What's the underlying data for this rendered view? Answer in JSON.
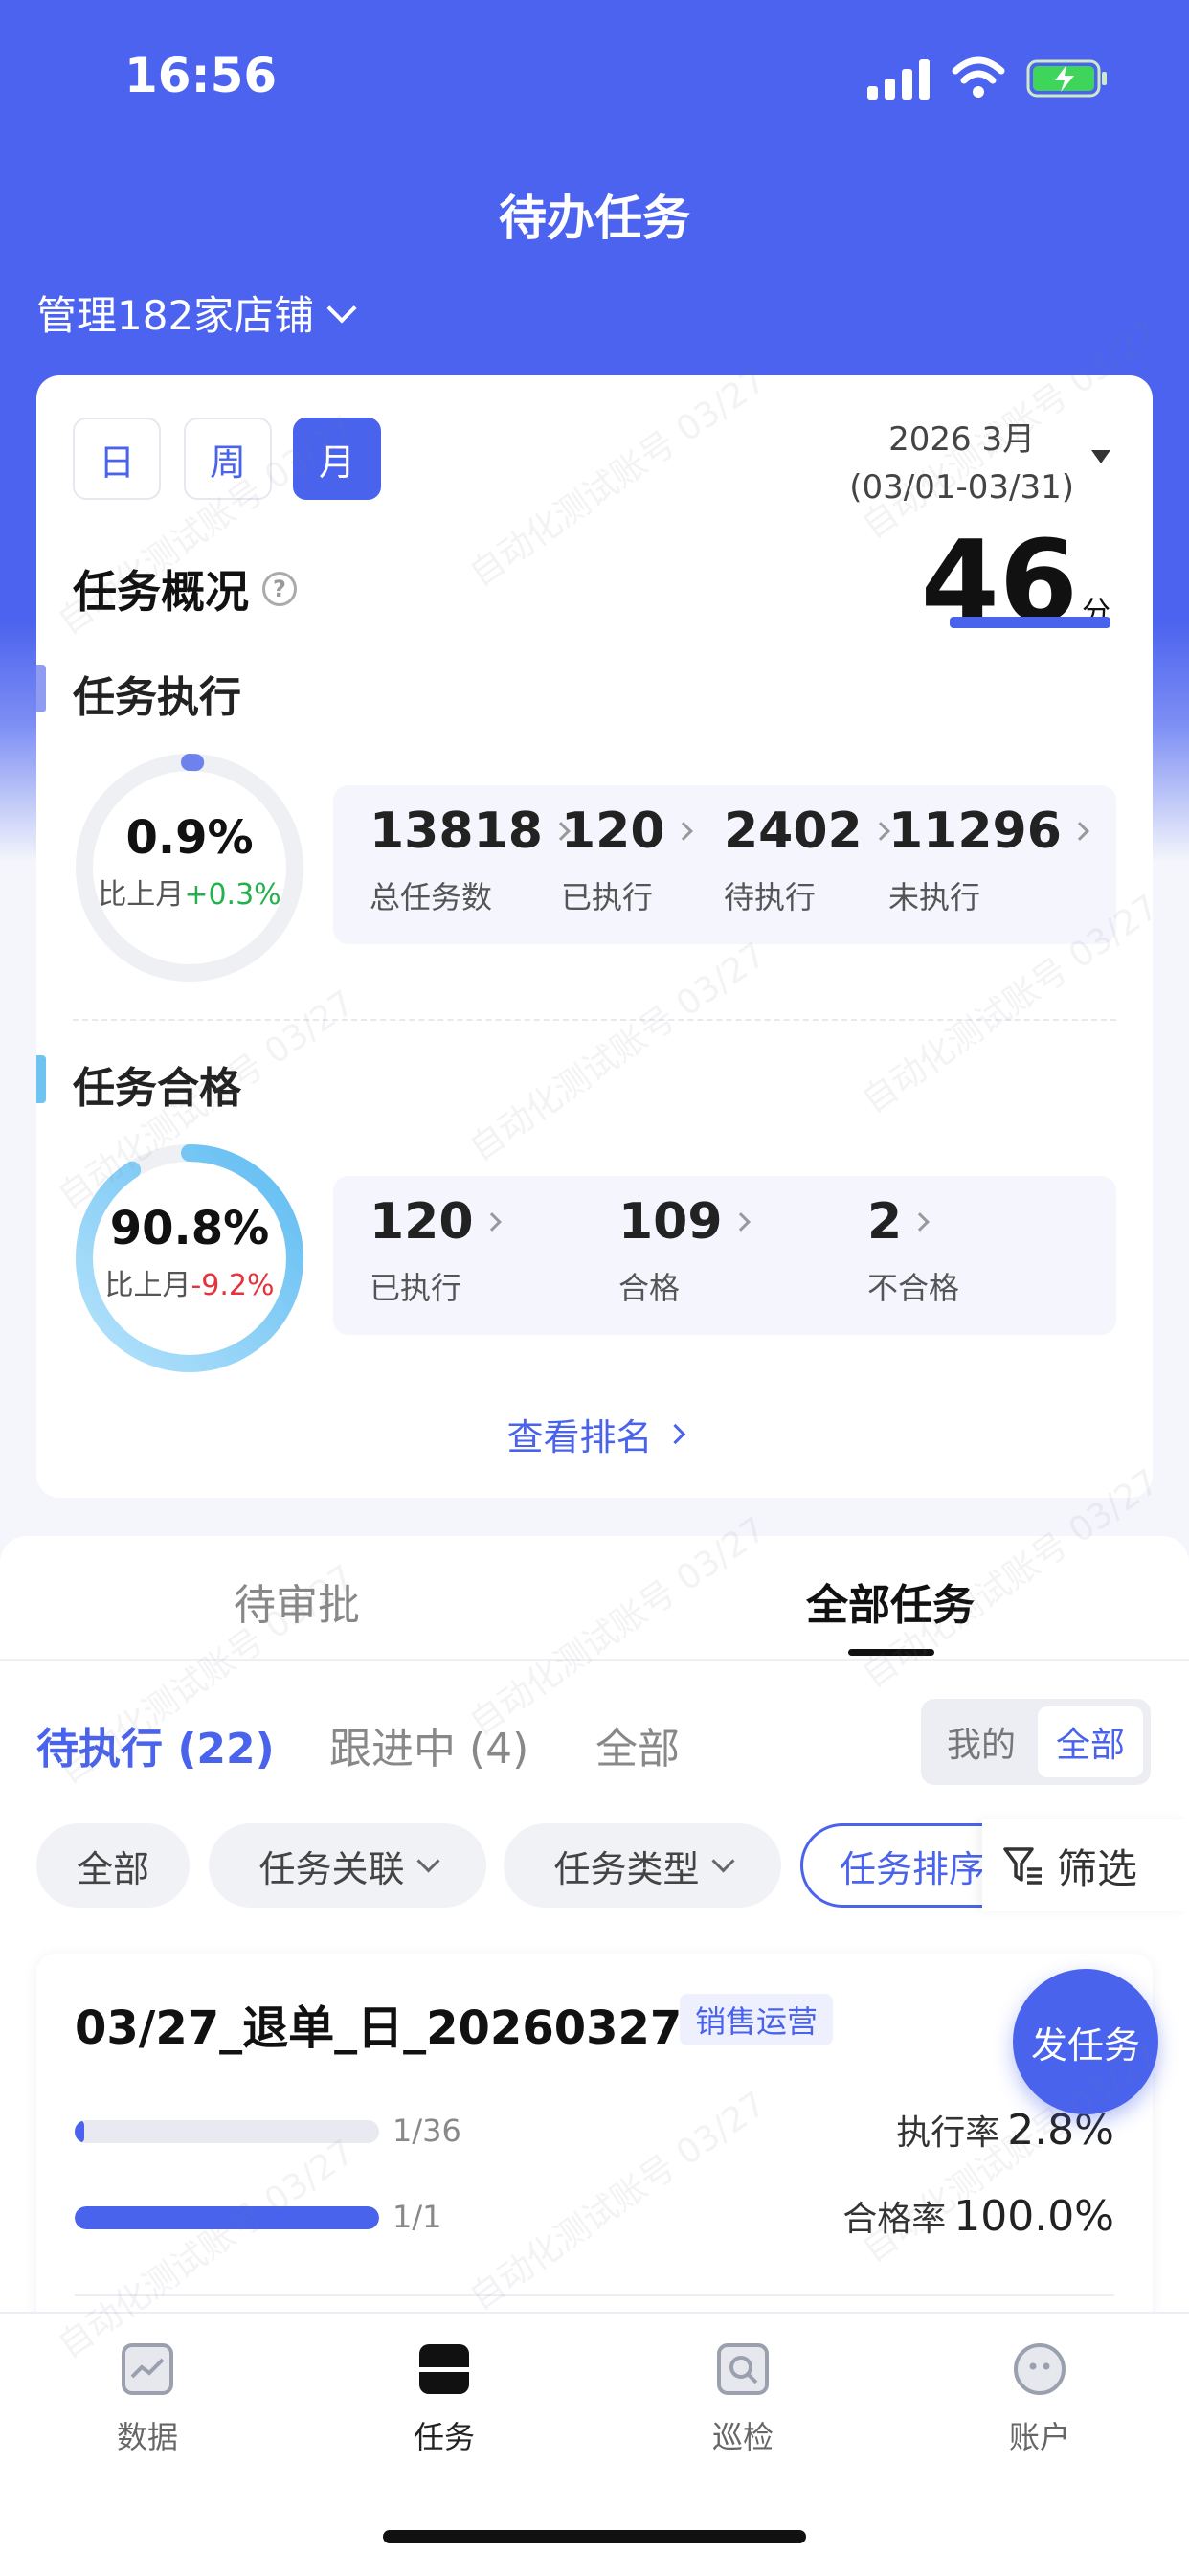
{
  "status_bar": {
    "time": "16:56"
  },
  "header": {
    "title": "待办任务",
    "store_selector": "管理182家店铺"
  },
  "overview": {
    "period_buttons": [
      "日",
      "周",
      "月"
    ],
    "active_period": "月",
    "date_line1": "2026 3月",
    "date_line2": "(03/01-03/31)",
    "title": "任务概况",
    "help_icon": "?",
    "score": "46",
    "score_unit": "分",
    "execution": {
      "title": "任务执行",
      "rate": "0.9%",
      "rate_value": 0.009,
      "compare_label": "比上月",
      "compare_value": "+0.3%",
      "stats": [
        {
          "value": "13818",
          "label": "总任务数"
        },
        {
          "value": "120",
          "label": "已执行"
        },
        {
          "value": "2402",
          "label": "待执行"
        },
        {
          "value": "11296",
          "label": "未执行"
        }
      ]
    },
    "qualified": {
      "title": "任务合格",
      "rate": "90.8%",
      "rate_value": 0.908,
      "compare_label": "比上月",
      "compare_value": "-9.2%",
      "stats": [
        {
          "value": "120",
          "label": "已执行"
        },
        {
          "value": "109",
          "label": "合格"
        },
        {
          "value": "2",
          "label": "不合格"
        }
      ]
    },
    "view_ranking": "查看排名"
  },
  "tabs": {
    "main": [
      "待审批",
      "全部任务"
    ],
    "active_main": "全部任务",
    "sub": [
      "待执行 (22)",
      "跟进中 (4)",
      "全部"
    ],
    "active_sub": "待执行 (22)",
    "scope_toggle": [
      "我的",
      "全部"
    ],
    "active_scope": "全部",
    "chips": [
      "全部",
      "任务关联",
      "任务类型",
      "任务排序"
    ],
    "filter": "筛选"
  },
  "task": {
    "title": "03/27_退单_日_20260327",
    "tag": "销售运营",
    "exec_fraction": "1/36",
    "exec_progress": 0.028,
    "exec_rate_label": "执行率",
    "exec_rate": "2.8%",
    "pass_fraction": "1/1",
    "pass_progress": 1.0,
    "pass_rate_label": "合格率",
    "pass_rate": "100.0%"
  },
  "fab": {
    "label": "发任务"
  },
  "bottom_nav": [
    {
      "label": "数据",
      "icon": "chart-icon"
    },
    {
      "label": "任务",
      "icon": "task-icon"
    },
    {
      "label": "巡检",
      "icon": "inspect-icon"
    },
    {
      "label": "账户",
      "icon": "account-icon"
    }
  ],
  "active_nav": "任务",
  "watermark": "自动化测试账号 03/27",
  "colors": {
    "primary": "#4a63ec",
    "up": "#22b14c",
    "down": "#e5323b",
    "ring_light": "#8fd0f4"
  }
}
